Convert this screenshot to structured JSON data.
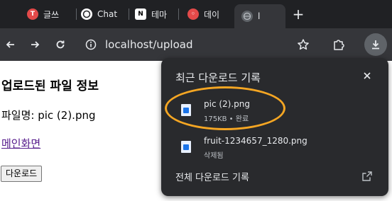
{
  "tabs": [
    {
      "label": "글쓰",
      "icon": "t-logo-icon",
      "color": "#e34a4a"
    },
    {
      "label": "Chat",
      "icon": "chatgpt-icon",
      "color": "#ffffff"
    },
    {
      "label": "테마",
      "icon": "notion-icon",
      "color": "#ffffff"
    },
    {
      "label": "데이",
      "icon": "red-logo-icon",
      "color": "#e34a4a"
    },
    {
      "label": "l",
      "icon": "globe-icon",
      "color": "#9aa0a6"
    }
  ],
  "toolbar": {
    "url": "localhost/upload"
  },
  "page": {
    "heading": "업로드된 파일 정보",
    "filename_text": "파일명: pic (2).png",
    "main_link": "메인화면",
    "download_button": "다운로드"
  },
  "downloads": {
    "title": "최근 다운로드 기록",
    "items": [
      {
        "name": "pic (2).png",
        "status": "175KB • 완료"
      },
      {
        "name": "fruit-1234657_1280.png",
        "status": "삭제됨"
      }
    ],
    "footer": "전체 다운로드 기록"
  },
  "colors": {
    "tabstrip": "#202124",
    "toolbar": "#35363a",
    "bubble": "#292a2d",
    "highlight": "#f5a623",
    "visited_link": "#551a8b"
  }
}
